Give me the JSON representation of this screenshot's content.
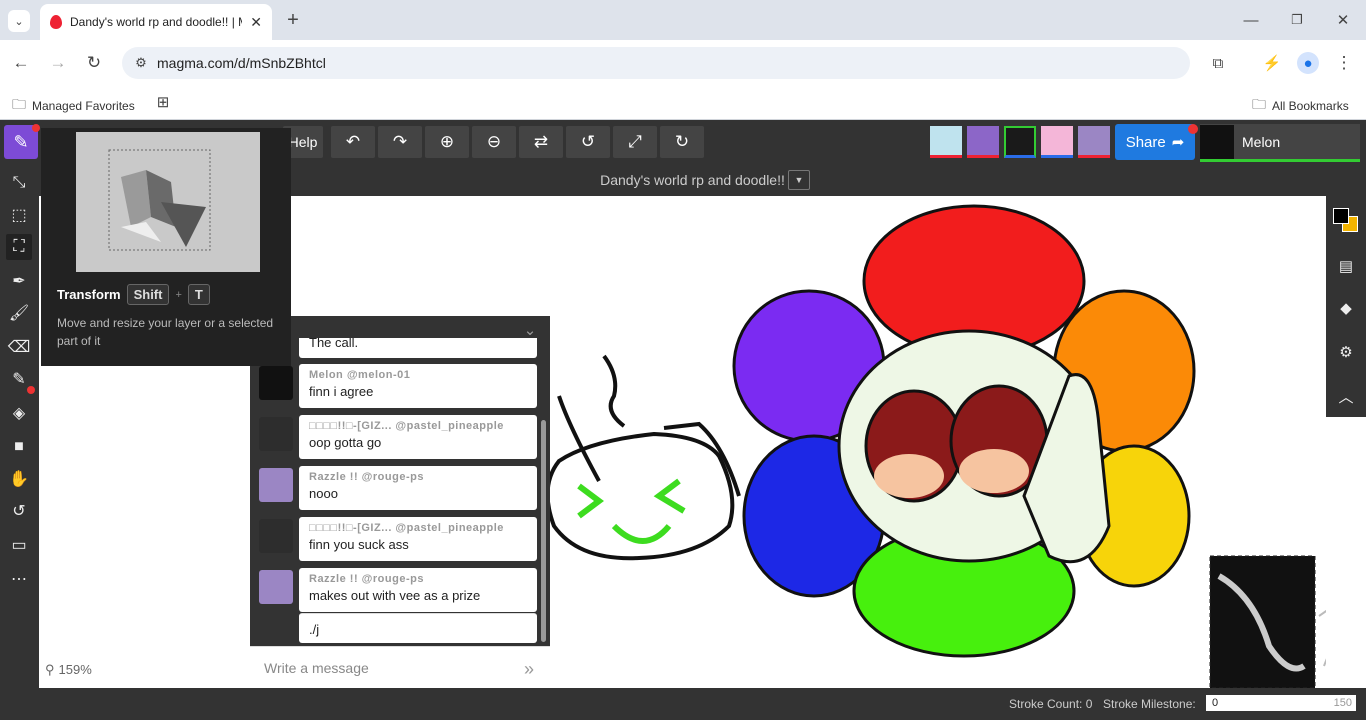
{
  "browser": {
    "tab_title": "Dandy's world rp and doodle!! | Magma",
    "url": "magma.com/d/mSnbZBhtcl",
    "bookmarks_left": "Managed Favorites",
    "bookmarks_right": "All Bookmarks"
  },
  "app": {
    "help_label": "Help",
    "share_label": "Share",
    "user_name": "Melon",
    "doc_title": "Dandy's world rp and doodle!!",
    "zoom": "159%"
  },
  "tooltip": {
    "title": "Transform",
    "key1": "Shift",
    "plus": "+",
    "key2": "T",
    "desc": "Move and resize your layer or a selected part of it"
  },
  "chat": {
    "partial": "The call.",
    "messages": [
      {
        "author": "Melon @melon-01",
        "text": "finn i agree",
        "avatar_color": "#111"
      },
      {
        "author": "□□□□!!□-[GIZ... @pastel_pineapple",
        "text": "oop gotta go",
        "avatar_color": "#2d2d2d"
      },
      {
        "author": "Razzle !! @rouge-ps",
        "text": "nooo",
        "avatar_color": "#9b86c4"
      },
      {
        "author": "□□□□!!□-[GIZ... @pastel_pineapple",
        "text": "finn you suck ass",
        "avatar_color": "#2d2d2d"
      },
      {
        "author": "Razzle !! @rouge-ps",
        "text": "makes out with vee as a prize",
        "avatar_color": "#9b86c4"
      }
    ],
    "last_text": "./j",
    "placeholder": "Write a message"
  },
  "status": {
    "stroke_count": "Stroke Count: 0",
    "milestone_label": "Stroke Milestone:",
    "milestone_value": "0",
    "milestone_max": "150",
    "milestone_progress": 0
  }
}
